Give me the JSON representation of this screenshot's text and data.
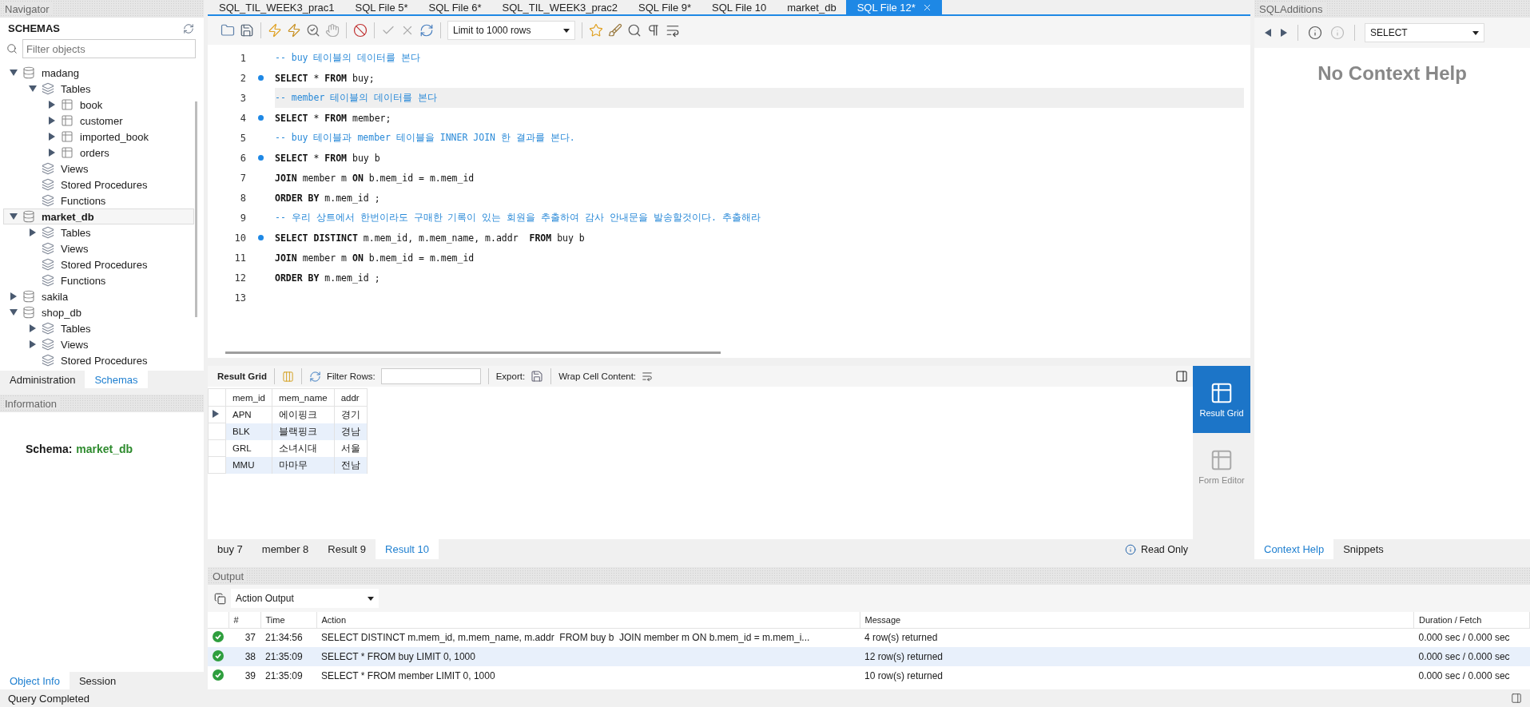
{
  "navigator": {
    "title": "Navigator",
    "heading": "SCHEMAS",
    "filter": {
      "placeholder": "Filter objects"
    },
    "tree": [
      {
        "label": "madang",
        "kind": "schema",
        "expanded": true,
        "selected": false,
        "children": [
          {
            "label": "Tables",
            "kind": "folder",
            "expanded": true,
            "children": [
              {
                "label": "book",
                "kind": "table",
                "expanded": false
              },
              {
                "label": "customer",
                "kind": "table",
                "expanded": false
              },
              {
                "label": "imported_book",
                "kind": "table",
                "expanded": false
              },
              {
                "label": "orders",
                "kind": "table",
                "expanded": false
              }
            ]
          },
          {
            "label": "Views",
            "kind": "folder"
          },
          {
            "label": "Stored Procedures",
            "kind": "folder"
          },
          {
            "label": "Functions",
            "kind": "folder"
          }
        ]
      },
      {
        "label": "market_db",
        "kind": "schema",
        "expanded": true,
        "selected": true,
        "children": [
          {
            "label": "Tables",
            "kind": "folder",
            "expanded": false
          },
          {
            "label": "Views",
            "kind": "folder"
          },
          {
            "label": "Stored Procedures",
            "kind": "folder"
          },
          {
            "label": "Functions",
            "kind": "folder"
          }
        ]
      },
      {
        "label": "sakila",
        "kind": "schema",
        "expanded": false,
        "selected": false
      },
      {
        "label": "shop_db",
        "kind": "schema",
        "expanded": true,
        "selected": false,
        "children": [
          {
            "label": "Tables",
            "kind": "folder",
            "expanded": false
          },
          {
            "label": "Views",
            "kind": "folder",
            "expanded": false
          },
          {
            "label": "Stored Procedures",
            "kind": "folder"
          }
        ]
      }
    ],
    "tabs": [
      {
        "label": "Administration",
        "selected": false
      },
      {
        "label": "Schemas",
        "selected": true
      }
    ]
  },
  "information": {
    "title": "Information",
    "schema_label": "Schema:",
    "schema_value": "market_db",
    "tabs": [
      {
        "label": "Object Info",
        "selected": true
      },
      {
        "label": "Session",
        "selected": false
      }
    ]
  },
  "editor_tabs": [
    {
      "label": "SQL_TIL_WEEK3_prac1",
      "selected": false
    },
    {
      "label": "SQL File 5*",
      "selected": false
    },
    {
      "label": "SQL File 6*",
      "selected": false
    },
    {
      "label": "SQL_TIL_WEEK3_prac2",
      "selected": false
    },
    {
      "label": "SQL File 9*",
      "selected": false
    },
    {
      "label": "SQL File 10",
      "selected": false
    },
    {
      "label": "market_db",
      "selected": false
    },
    {
      "label": "SQL File 12*",
      "selected": true
    }
  ],
  "toolbar": {
    "limit": "Limit to 1000 rows"
  },
  "code": [
    {
      "number": "1",
      "marker": false,
      "current": false,
      "kind": "comment",
      "text": "-- buy 테이블의 데이터를 본다"
    },
    {
      "number": "2",
      "marker": true,
      "current": false,
      "kind": "code",
      "text": "**SELECT** * **FROM** buy;"
    },
    {
      "number": "3",
      "marker": false,
      "current": true,
      "kind": "comment",
      "text": "-- member 테이블의 데이터를 본다"
    },
    {
      "number": "4",
      "marker": true,
      "current": false,
      "kind": "code",
      "text": "**SELECT** * **FROM** member;"
    },
    {
      "number": "5",
      "marker": false,
      "current": false,
      "kind": "comment",
      "text": "-- buy 테이블과 member 테이블을 INNER JOIN 한 결과를 본다."
    },
    {
      "number": "6",
      "marker": true,
      "current": false,
      "kind": "code",
      "text": "**SELECT** * **FROM** buy b"
    },
    {
      "number": "7",
      "marker": false,
      "current": false,
      "kind": "code",
      "text": "**JOIN** member m **ON** b.mem_id = m.mem_id"
    },
    {
      "number": "8",
      "marker": false,
      "current": false,
      "kind": "code",
      "text": "**ORDER BY** m.mem_id ;"
    },
    {
      "number": "9",
      "marker": false,
      "current": false,
      "kind": "comment",
      "text": "-- 우리 상트에서 한번이라도 구매한 기록이 있는 회원을 추출하여 감사 안내문을 발송할것이다. 추출해라"
    },
    {
      "number": "10",
      "marker": true,
      "current": false,
      "kind": "code",
      "text": "**SELECT DISTINCT** m.mem_id, m.mem_name, m.addr  **FROM** buy b"
    },
    {
      "number": "11",
      "marker": false,
      "current": false,
      "kind": "code",
      "text": "**JOIN** member m **ON** b.mem_id = m.mem_id"
    },
    {
      "number": "12",
      "marker": false,
      "current": false,
      "kind": "code",
      "text": "**ORDER BY** m.mem_id ;"
    },
    {
      "number": "13"
    }
  ],
  "result": {
    "label": "Result Grid",
    "filter_label": "Filter Rows:",
    "export_label": "Export:",
    "wrap_label": "Wrap Cell Content:",
    "columns": [
      "mem_id",
      "mem_name",
      "addr"
    ],
    "rows": [
      {
        "selected": true,
        "cells": [
          "APN",
          "에이핑크",
          "경기"
        ]
      },
      {
        "selected": false,
        "cells": [
          "BLK",
          "블랙핑크",
          "경남"
        ]
      },
      {
        "selected": false,
        "cells": [
          "GRL",
          "소녀시대",
          "서울"
        ]
      },
      {
        "selected": false,
        "cells": [
          "MMU",
          "마마무",
          "전남"
        ]
      }
    ],
    "side": [
      {
        "label": "Result Grid",
        "selected": true
      },
      {
        "label": "Form Editor",
        "selected": false
      }
    ],
    "tabs": [
      {
        "label": "buy 7",
        "selected": false
      },
      {
        "label": "member 8",
        "selected": false
      },
      {
        "label": "Result 9",
        "selected": false
      },
      {
        "label": "Result 10",
        "selected": true
      }
    ],
    "status": "Read Only"
  },
  "sql_additions": {
    "title": "SQLAdditions",
    "select": "SELECT",
    "message": "No Context Help",
    "tabs": [
      {
        "label": "Context Help",
        "selected": true
      },
      {
        "label": "Snippets",
        "selected": false
      }
    ]
  },
  "output": {
    "title": "Output",
    "mode": "Action Output",
    "columns": [
      "#",
      "Time",
      "Action",
      "Message",
      "Duration / Fetch"
    ],
    "rows": [
      {
        "success": true,
        "selected": false,
        "cells": [
          "37",
          "21:34:56",
          "SELECT DISTINCT m.mem_id, m.mem_name, m.addr  FROM buy b  JOIN member m ON b.mem_id = m.mem_i...",
          "4 row(s) returned",
          "0.000 sec / 0.000 sec"
        ]
      },
      {
        "success": true,
        "selected": true,
        "cells": [
          "38",
          "21:35:09",
          "SELECT * FROM buy LIMIT 0, 1000",
          "12 row(s) returned",
          "0.000 sec / 0.000 sec"
        ]
      },
      {
        "success": true,
        "selected": false,
        "cells": [
          "39",
          "21:35:09",
          "SELECT * FROM member LIMIT 0, 1000",
          "10 row(s) returned",
          "0.000 sec / 0.000 sec"
        ]
      }
    ]
  },
  "status_bar": {
    "text": "Query Completed"
  }
}
